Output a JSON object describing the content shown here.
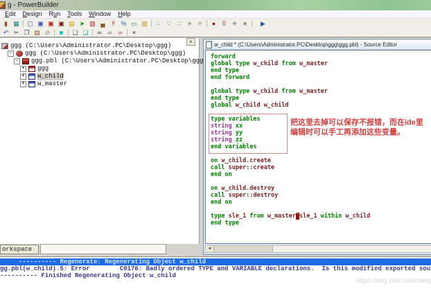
{
  "window": {
    "title": "g - PowerBuilder"
  },
  "menu": {
    "items": [
      {
        "label": "Edit",
        "u": 0
      },
      {
        "label": "Design",
        "u": 0
      },
      {
        "label": "Run",
        "u": 1
      },
      {
        "label": "Tools",
        "u": 0
      },
      {
        "label": "Window",
        "u": 0
      },
      {
        "label": "Help",
        "u": 0
      }
    ]
  },
  "toolbar_row1": [
    {
      "n": "paint-icon",
      "g": "▮",
      "c": "#a84a2a"
    },
    {
      "n": "library-painter-icon",
      "g": "▦",
      "c": "#1f7f7f"
    },
    {
      "sep": true
    },
    {
      "n": "window-painter-icon",
      "g": "▢",
      "c": "#3355aa"
    },
    {
      "n": "window-grid-icon",
      "g": "▣",
      "c": "#3355aa"
    },
    {
      "n": "datawindow-painter-icon",
      "g": "▣",
      "c": "#aa2222"
    },
    {
      "n": "report-painter-icon",
      "g": "▣",
      "c": "#771111"
    },
    {
      "n": "form-painter-icon",
      "g": "▤",
      "c": "#c8a000"
    },
    {
      "n": "run-icon",
      "g": "➤",
      "c": "#1a8a1a"
    },
    {
      "n": "database-painter-icon",
      "g": "▥",
      "c": "#aa2222"
    },
    {
      "n": "briefcase-icon",
      "g": "▄",
      "c": "#8a5a2a"
    },
    {
      "n": "debug-icon",
      "g": "‼",
      "c": "#cc2222"
    },
    {
      "n": "percent-icon",
      "g": "%",
      "c": "#4466aa"
    },
    {
      "n": "printer-icon",
      "g": "▭",
      "c": "#2a7a7a"
    },
    {
      "n": "edit-source-icon",
      "g": "▨",
      "c": "#b89a2a"
    },
    {
      "sep": true
    },
    {
      "n": "scatter-chart-icon",
      "g": "∴",
      "c": "#2a4acc"
    },
    {
      "n": "scatter-chart2-icon",
      "g": "∵",
      "c": "#2a4acc"
    },
    {
      "n": "graph-icon",
      "g": "∷",
      "c": "#2a8a5a"
    },
    {
      "n": "pattern-icon",
      "g": "∗",
      "c": "#8a8a8a"
    },
    {
      "n": "flower-icon",
      "g": "✳",
      "c": "#9a9a9a"
    },
    {
      "sep": true
    },
    {
      "n": "sphere-icon",
      "g": "●",
      "c": "#991515"
    },
    {
      "n": "dots-grid-icon",
      "g": "⠿",
      "c": "#aa3344"
    },
    {
      "n": "flower2-icon",
      "g": "✳",
      "c": "#7a5a8a"
    },
    {
      "n": "speckle-icon",
      "g": "∗",
      "c": "#666666"
    },
    {
      "sep": true
    },
    {
      "n": "exit-icon",
      "g": "▶",
      "c": "#2255aa",
      "ml": 6
    }
  ],
  "toolbar_row2": [
    {
      "n": "undo-icon",
      "g": "↶",
      "c": "#2a4acc"
    },
    {
      "n": "cut-icon",
      "g": "✂",
      "c": "#444444"
    },
    {
      "n": "copy-icon",
      "g": "❐",
      "c": "#334a7a"
    },
    {
      "n": "paste-icon",
      "g": "▤",
      "c": "#8a5a2a"
    },
    {
      "n": "clear-icon",
      "g": "⊘",
      "c": "#888888"
    },
    {
      "sep": true
    },
    {
      "n": "select-icon",
      "g": "■",
      "c": "#00b4b4"
    },
    {
      "sep": true
    },
    {
      "n": "comment-icon",
      "g": "❏",
      "c": "#555555"
    },
    {
      "n": "uncomment-icon",
      "g": "❏",
      "c": "#00a0a0"
    },
    {
      "sep": true
    },
    {
      "n": "find-icon",
      "g": "∞",
      "c": "#333333"
    },
    {
      "n": "find-next-icon",
      "g": "∞",
      "c": "#777777"
    },
    {
      "n": "replace-icon",
      "g": "∞",
      "c": "#a05050"
    },
    {
      "sep": true
    },
    {
      "n": "close-icon",
      "g": "×",
      "c": "#111111"
    }
  ],
  "tree": {
    "rows": [
      {
        "name": "tree-item-workspace-ggg",
        "indent": 0,
        "expand": "",
        "icon": "workspace",
        "label": "ggg (C:\\Users\\Administrator.PC\\Desktop\\ggg)",
        "selected": false
      },
      {
        "name": "tree-item-target-ggg",
        "indent": 1,
        "expand": "-",
        "icon": "app",
        "label": "ggg (C:\\Users\\Administrator.PC\\Desktop\\ggg)",
        "selected": false
      },
      {
        "name": "tree-item-library-ggg-pbl",
        "indent": 2,
        "expand": "-",
        "icon": "lib",
        "label": "ggg.pbl (C:\\Users\\Administrator.PC\\Desktop\\ggg)",
        "selected": false
      },
      {
        "name": "tree-item-application-ggg",
        "indent": 3,
        "expand": "+",
        "icon": "winred",
        "label": "ggg",
        "selected": false
      },
      {
        "name": "tree-item-w-child",
        "indent": 3,
        "expand": "+",
        "icon": "winblue",
        "label": "w_child",
        "selected": true
      },
      {
        "name": "tree-item-w-master",
        "indent": 3,
        "expand": "+",
        "icon": "winblue",
        "label": "w_master",
        "selected": false
      }
    ]
  },
  "workspace_tab": "orkspace",
  "editor": {
    "title": "w_child * (C:\\Users\\Administrator.PC\\Desktop\\ggg\\ggg.pbl) - Source Editor",
    "syntax_colors": {
      "keyword": "#008200",
      "identifier": "#7c2222",
      "datatype": "#a332a3",
      "selection_bg": "#8b1212"
    },
    "annotation": [
      "把这里去掉可以保存不报错，而在ide里",
      "编辑时可以手工再添加这些变量。"
    ],
    "lines": [
      [
        {
          "t": "forward",
          "c": "kw"
        }
      ],
      [
        {
          "t": "global type ",
          "c": "kw"
        },
        {
          "t": "w_child",
          "c": "id"
        },
        {
          "t": " from ",
          "c": "kw"
        },
        {
          "t": "w_master",
          "c": "id"
        }
      ],
      [
        {
          "t": "end type",
          "c": "kw"
        }
      ],
      [
        {
          "t": "end forward",
          "c": "kw"
        }
      ],
      [],
      [
        {
          "t": "global type ",
          "c": "kw"
        },
        {
          "t": "w_child",
          "c": "id"
        },
        {
          "t": " from ",
          "c": "kw"
        },
        {
          "t": "w_master",
          "c": "id"
        }
      ],
      [
        {
          "t": "end type",
          "c": "kw"
        }
      ],
      [
        {
          "t": "global ",
          "c": "kw"
        },
        {
          "t": "w_child w_child",
          "c": "id"
        }
      ],
      [],
      [
        {
          "t": "type variables",
          "c": "kw"
        }
      ],
      [
        {
          "t": "string",
          "c": "dt"
        },
        {
          "t": " xx",
          "c": "kw"
        }
      ],
      [
        {
          "t": "string",
          "c": "dt"
        },
        {
          "t": " yy",
          "c": "kw"
        }
      ],
      [
        {
          "t": "string",
          "c": "dt"
        },
        {
          "t": " zz",
          "c": "kw"
        }
      ],
      [
        {
          "t": "end variables",
          "c": "kw"
        }
      ],
      [],
      [
        {
          "t": "on ",
          "c": "kw"
        },
        {
          "t": "w_child.create",
          "c": "id"
        }
      ],
      [
        {
          "t": "call ",
          "c": "kw"
        },
        {
          "t": "super::create",
          "c": "id"
        }
      ],
      [
        {
          "t": "end on",
          "c": "kw"
        }
      ],
      [],
      [
        {
          "t": "on ",
          "c": "kw"
        },
        {
          "t": "w_child.destroy",
          "c": "id"
        }
      ],
      [
        {
          "t": "call ",
          "c": "kw"
        },
        {
          "t": "super::destroy",
          "c": "id"
        }
      ],
      [
        {
          "t": "end on",
          "c": "kw"
        }
      ],
      [],
      [
        {
          "t": "type ",
          "c": "kw"
        },
        {
          "t": "sle_1",
          "c": "id"
        },
        {
          "t": " from ",
          "c": "kw"
        },
        {
          "t": "w_master",
          "c": "id"
        },
        {
          "t": "`",
          "c": "sel"
        },
        {
          "t": "sle_1",
          "c": "id"
        },
        {
          "t": " within ",
          "c": "kw"
        },
        {
          "t": "w_child",
          "c": "id"
        }
      ],
      [
        {
          "t": "end type",
          "c": "kw"
        }
      ]
    ]
  },
  "output": {
    "lines": [
      {
        "text": "     ---------- Regenerate: Regenerating Object w_child",
        "selected": true
      },
      {
        "text": "gg.pbl(w_child).5: Error        C0176: Badly ordered TYPE and VARIABLE declarations.  Is this modified exported source?",
        "selected": false
      },
      {
        "text": "---------- Finished Regenerating Object w_child",
        "selected": false
      }
    ]
  },
  "watermark": "https://blog.csdn.net/chengg"
}
